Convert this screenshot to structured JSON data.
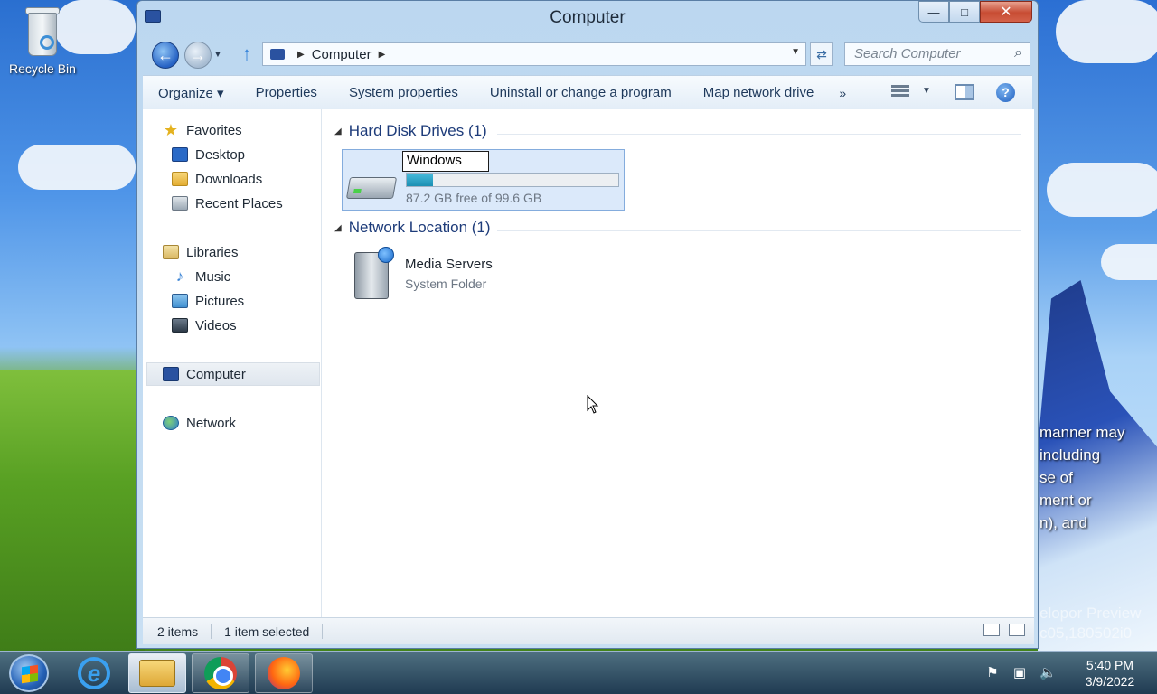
{
  "desktop": {
    "recycle_bin_label": "Recycle Bin",
    "wallpaper_text_lines": [
      "manner may",
      "including",
      "se of",
      "ment or",
      "n), and"
    ],
    "build_text_lines": [
      "elopor Preview",
      "c05,180502i0"
    ]
  },
  "window": {
    "title": "Computer",
    "min_glyph": "—",
    "max_glyph": "□",
    "close_glyph": "✕"
  },
  "address_bar": {
    "back_glyph": "←",
    "forward_glyph": "→",
    "up_glyph": "↑",
    "path": "Computer",
    "search_placeholder": "Search Computer",
    "search_glyph": "⌕",
    "refresh_glyph": "⇄"
  },
  "command_bar": {
    "items": [
      {
        "label": "Organize ▾"
      },
      {
        "label": "Properties"
      },
      {
        "label": "System properties"
      },
      {
        "label": "Uninstall or change a program"
      },
      {
        "label": "Map network drive"
      }
    ],
    "more_glyph": "»",
    "help_glyph": "?"
  },
  "nav_pane": {
    "favorites": "Favorites",
    "desktop": "Desktop",
    "downloads": "Downloads",
    "recent_places": "Recent Places",
    "libraries": "Libraries",
    "music": "Music",
    "pictures": "Pictures",
    "videos": "Videos",
    "computer": "Computer",
    "network": "Network"
  },
  "content": {
    "hard_disk_group": "Hard Disk Drives (1)",
    "drive": {
      "name_edit_value": "Windows",
      "used_fraction": 0.125,
      "free_text": "87.2 GB free of 99.6 GB"
    },
    "network_group": "Network Location (1)",
    "network_item": {
      "name": "Media Servers",
      "type": "System Folder"
    }
  },
  "status_bar": {
    "item_count": "2 items",
    "selection": "1 item selected"
  },
  "taskbar": {
    "ie_glyph": "e",
    "time": "5:40 PM",
    "date": "3/9/2022"
  },
  "colors": {
    "accent": "#1e3c7a",
    "drive_fill": "#1b8fb3",
    "selection_bg": "#dbe9fa"
  }
}
